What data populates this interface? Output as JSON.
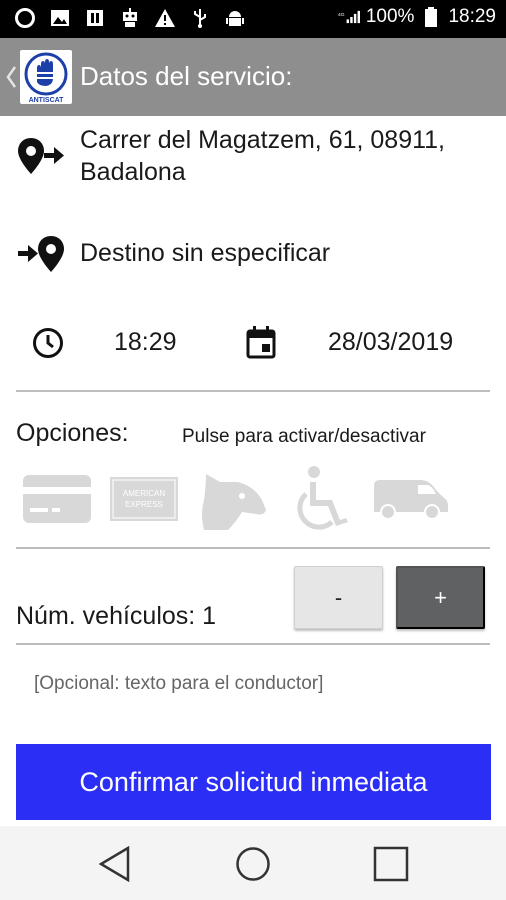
{
  "status_bar": {
    "battery_percent": "100%",
    "time": "18:29",
    "icons": [
      "circle-icon",
      "image-icon",
      "pause-icon",
      "robot-icon",
      "warning-icon",
      "usb-icon",
      "android-icon",
      "signal-icon",
      "battery-icon"
    ]
  },
  "action_bar": {
    "title": "Datos del servicio:",
    "logo_text": "ANTISCAT"
  },
  "service": {
    "origin": [
      "Carrer del Magatzem, 61, 08911,",
      "Badalona"
    ],
    "destination": "Destino sin especificar",
    "time": "18:29",
    "date": "28/03/2019"
  },
  "options": {
    "label": "Opciones:",
    "hint": "Pulse para activar/desactivar",
    "items": [
      "credit-card",
      "american-express",
      "dog",
      "wheelchair",
      "van"
    ],
    "amex_line1": "AMERICAN",
    "amex_line2": "EXPRESS"
  },
  "vehicles": {
    "label": "Núm. vehículos: 1",
    "minus_label": "-",
    "plus_label": "+"
  },
  "note": {
    "placeholder": "[Opcional: texto para el conductor]"
  },
  "confirm": {
    "label": "Confirmar solicitud inmediata"
  },
  "colors": {
    "action_bar": "#8e8e8e",
    "confirm_button": "#2b2ef5",
    "plus_button": "#5f6163",
    "disabled_icon": "#d8d8d8"
  }
}
